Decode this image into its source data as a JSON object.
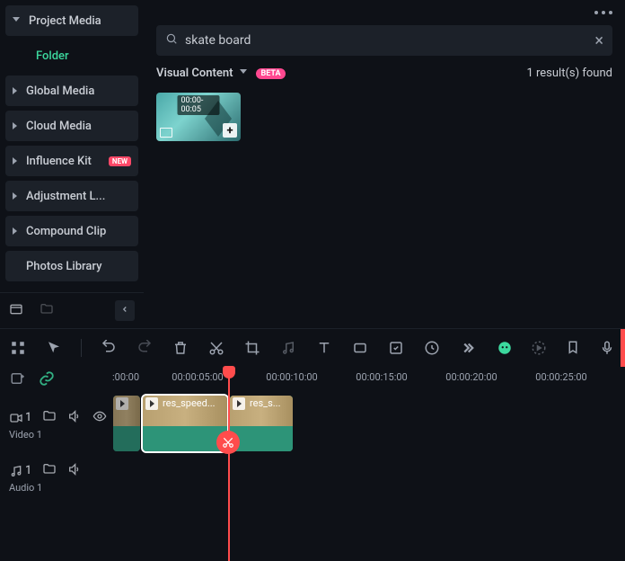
{
  "sidebar": {
    "items": [
      {
        "label": "Project Media",
        "expanded": true
      },
      {
        "label": "Folder",
        "child": true,
        "active": true
      },
      {
        "label": "Global Media"
      },
      {
        "label": "Cloud Media"
      },
      {
        "label": "Influence Kit",
        "tag": "NEW"
      },
      {
        "label": "Adjustment L..."
      },
      {
        "label": "Compound Clip"
      },
      {
        "label": "Photos Library",
        "no_chevron": true
      }
    ]
  },
  "search": {
    "value": "skate board"
  },
  "filter": {
    "label": "Visual Content",
    "badge": "BETA"
  },
  "results": {
    "count_text": "1 result(s) found"
  },
  "thumb": {
    "timerange": "00:00-00:05"
  },
  "ruler": {
    "ticks": [
      ":00:00",
      "00:00:05:00",
      "00:00:10:00",
      "00:00:15:00",
      "00:00:20:00",
      "00:00:25:00"
    ]
  },
  "tracks": {
    "video": {
      "badge_num": "1",
      "label": "Video 1"
    },
    "audio": {
      "badge_num": "1",
      "label": "Audio 1"
    }
  },
  "clips": {
    "c1": {
      "title": "res_speed..."
    },
    "c2": {
      "title": "res_s..."
    }
  }
}
